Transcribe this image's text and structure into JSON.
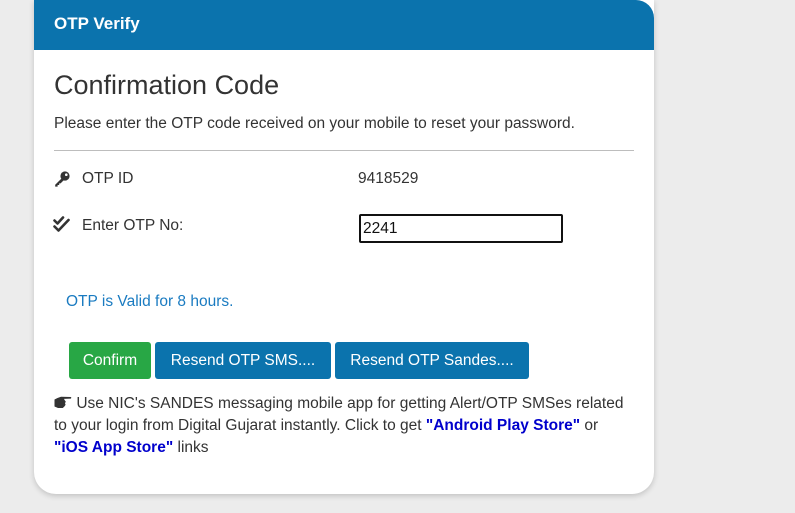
{
  "header": {
    "title": "OTP Verify"
  },
  "main": {
    "title": "Confirmation Code",
    "subtitle": "Please enter the OTP code received on your mobile to reset your password.",
    "otp_id": {
      "label": "OTP ID",
      "value": "9418529",
      "icon": "key-icon"
    },
    "otp_entry": {
      "label": "Enter OTP No:",
      "value": "2241",
      "icon": "double-check-icon"
    },
    "validity": "OTP is Valid for 8 hours."
  },
  "buttons": {
    "confirm": "Confirm",
    "resend_sms": "Resend OTP SMS....",
    "resend_sandes": "Resend OTP Sandes...."
  },
  "note": {
    "icon": "pointing-hand-icon",
    "text_before": "Use NIC's SANDES messaging mobile app for getting Alert/OTP SMSes related to your login from Digital Gujarat instantly. Click to get",
    "android_link": "\"Android Play Store\"",
    "middle": "or",
    "ios_link": "\"iOS App Store\"",
    "text_after": "links"
  },
  "colors": {
    "header_bg": "#0b73ad",
    "confirm_bg": "#28a745",
    "resend_bg": "#0b73ad",
    "validity_text": "#1a7bc1",
    "link": "#0000cc"
  }
}
